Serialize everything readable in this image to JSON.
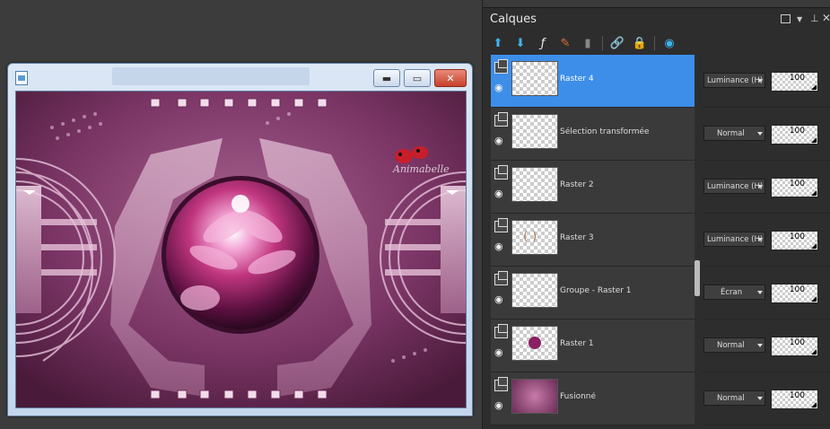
{
  "panel": {
    "title": "Calques",
    "toolbar_icons": [
      "move-up-icon",
      "move-down-icon",
      "fx-visibility-icon",
      "effects-brush-icon",
      "mask-icon",
      "link-icon",
      "lock-icon",
      "palette-icon"
    ]
  },
  "layers": [
    {
      "name": "Raster 4",
      "blend": "Luminance (H)",
      "opacity": "100",
      "selected": true,
      "thumb": "empty"
    },
    {
      "name": "Sélection transformée",
      "blend": "Normal",
      "opacity": "100",
      "selected": false,
      "thumb": "empty"
    },
    {
      "name": "Raster 2",
      "blend": "Luminance (H)",
      "opacity": "100",
      "selected": false,
      "thumb": "empty"
    },
    {
      "name": "Raster 3",
      "blend": "Luminance (H)",
      "opacity": "100",
      "selected": false,
      "thumb": "brackets"
    },
    {
      "name": "Groupe - Raster 1",
      "blend": "Écran",
      "opacity": "100",
      "selected": false,
      "thumb": "faint"
    },
    {
      "name": "Raster 1",
      "blend": "Normal",
      "opacity": "100",
      "selected": false,
      "thumb": "orb"
    },
    {
      "name": "Fusionné",
      "blend": "Normal",
      "opacity": "100",
      "selected": false,
      "thumb": "full"
    }
  ],
  "canvas": {
    "watermark": "Animabelle",
    "colors": {
      "base": "#6a2b55",
      "light": "#d9a8c8",
      "flower": "#c0367f",
      "accent": "#f7d5ea"
    }
  }
}
